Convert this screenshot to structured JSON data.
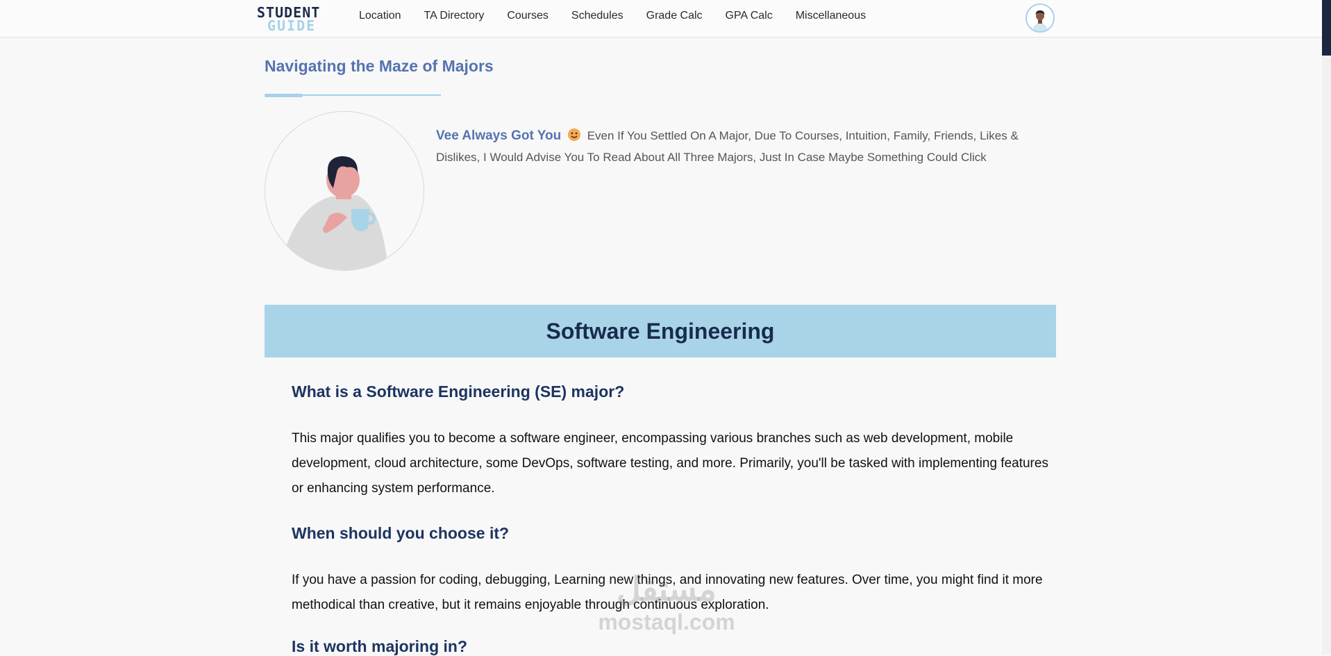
{
  "nav": {
    "logo_top": "STUDENT",
    "logo_bottom": "GUIDE",
    "links": [
      "Location",
      "TA Directory",
      "Courses",
      "Schedules",
      "Grade Calc",
      "GPA Calc",
      "Miscellaneous"
    ]
  },
  "page": {
    "title": "Navigating the Maze of Majors",
    "intro_lead": "Vee Always Got You",
    "intro_body": "Even If You Settled On A Major, Due To Courses, Intuition, Family, Friends, Likes & Dislikes, I Would Advise You To Read About All Three Majors, Just In Case Maybe Something Could Click"
  },
  "section": {
    "title": "Software Engineering",
    "q1": "What is a Software Engineering (SE) major?",
    "a1": "This major qualifies you to become a software engineer, encompassing various branches such as web development, mobile development, cloud architecture, some DevOps, software testing, and more. Primarily, you'll be tasked with implementing features or enhancing system performance.",
    "q2": "When should you choose it?",
    "a2": "If you have a passion for coding, debugging, Learning new things, and innovating new features. Over time, you might find it more methodical than creative, but it remains enjoyable through continuous exploration.",
    "q3": "Is it worth majoring in?"
  },
  "watermark": {
    "arabic": "مستقل",
    "latin": "mostaql.com"
  },
  "icons": {
    "avatar": "user-avatar-icon",
    "emoji": "smiling-face-emoji",
    "illustration": "person-with-mug-illustration"
  },
  "colors": {
    "accent": "#a6d1ea",
    "heading": "#5473b0",
    "banner": "#a9d4e8",
    "dark": "#182b4d"
  }
}
